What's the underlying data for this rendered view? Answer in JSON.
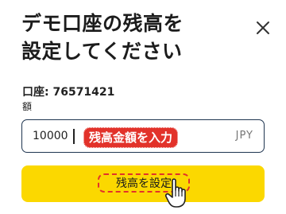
{
  "dialog": {
    "title_line1": "デモ口座の残高を",
    "title_line2": "設定してください",
    "close_label": "×"
  },
  "account": {
    "label_with_number": "口座: 76571421"
  },
  "amount": {
    "label": "額",
    "value": "10000",
    "currency": "JPY"
  },
  "annotation": {
    "text": "残高金額を入力"
  },
  "submit": {
    "label": "残高を設定"
  },
  "colors": {
    "button_yellow": "#fbd800",
    "annotation_red": "#e2322a",
    "input_border": "#1f3550"
  },
  "icons": [
    "close-icon",
    "hand-pointer-icon"
  ]
}
